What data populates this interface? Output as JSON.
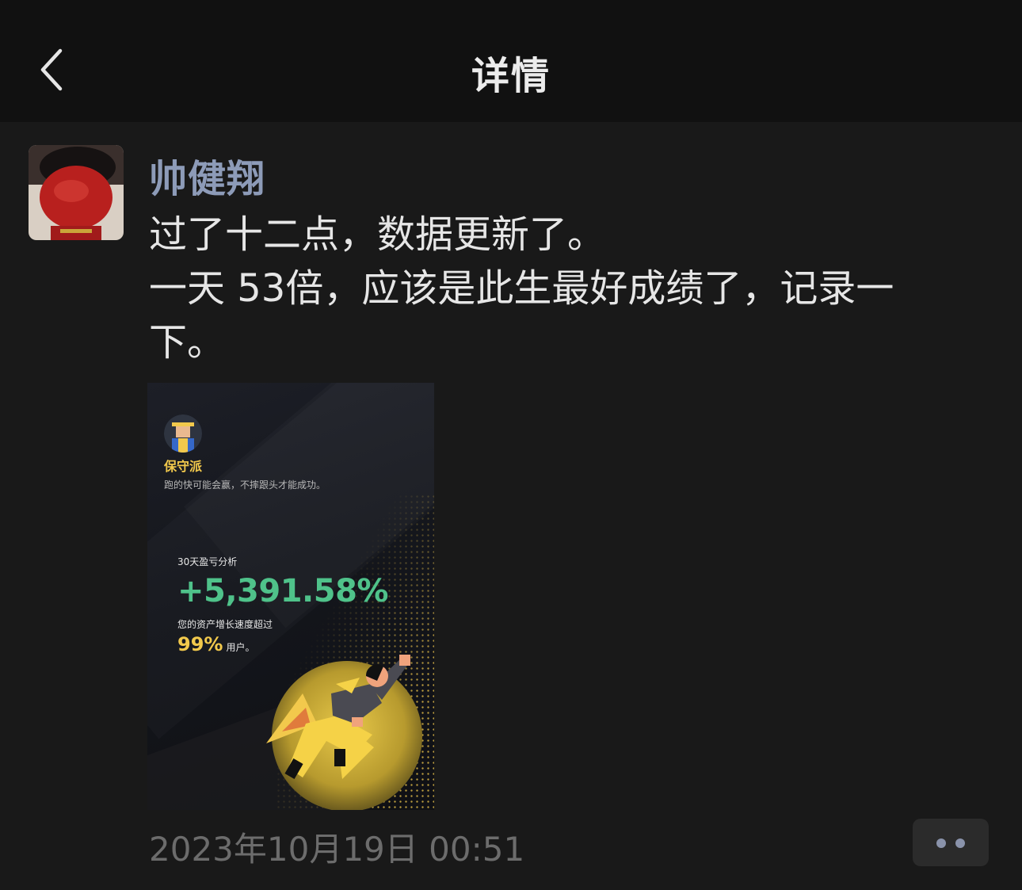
{
  "navbar": {
    "title": "详情",
    "back_icon": "chevron-left-icon"
  },
  "post": {
    "author": "帅健翔",
    "text_lines": [
      "过了十二点，数据更新了。",
      "一天 53倍，应该是此生最好成绩了，记录一",
      "下。"
    ],
    "timestamp": "2023年10月19日 00:51",
    "more_icon": "more-dots-icon"
  },
  "poster": {
    "style_name": "保守派",
    "slogan": "跑的快可能会赢，不摔跟头才能成功。",
    "analysis_label": "30天盈亏分析",
    "profit_percent": "+5,391.58%",
    "growth_text": "您的资产增长速度超过",
    "rank_value": "99%",
    "rank_suffix": "用户。"
  },
  "colors": {
    "background": "#191919",
    "navbar": "#111111",
    "author": "#8d9bb8",
    "profit_green": "#4fc28a",
    "accent_yellow": "#f2c94c",
    "timestamp": "#6c6c6c"
  }
}
